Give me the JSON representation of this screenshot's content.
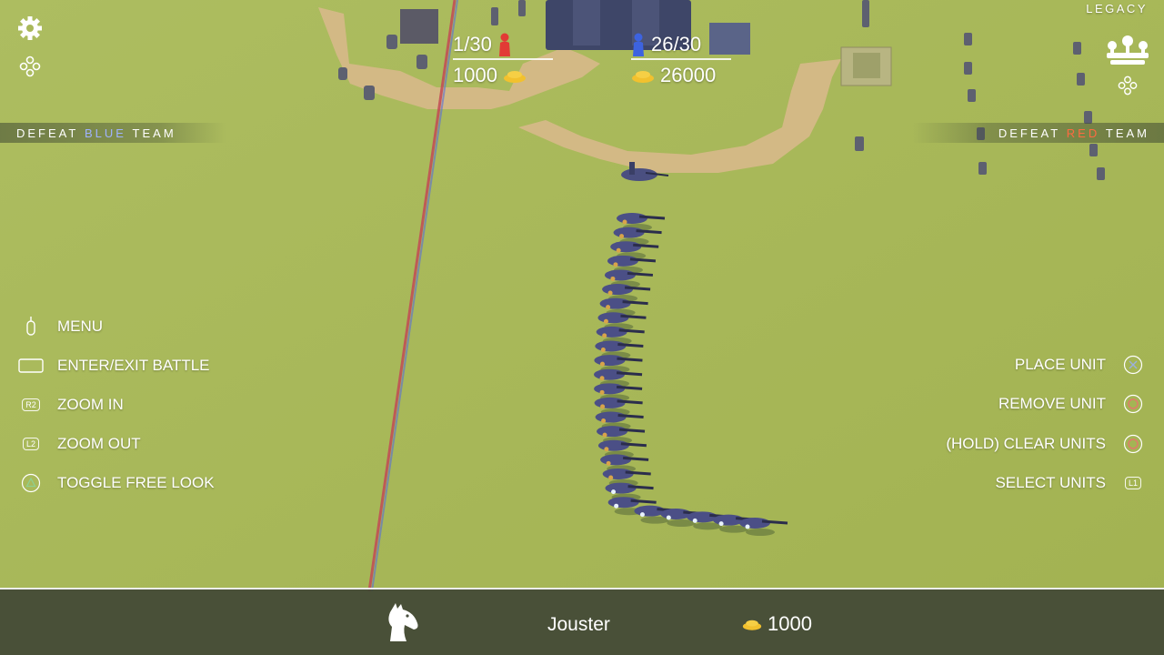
{
  "window": {
    "legacy_label": "LEGACY"
  },
  "teams": {
    "red": {
      "units": "1/30",
      "gold": "1000",
      "color": "#e23b35"
    },
    "blue": {
      "units": "26/30",
      "gold": "26000",
      "color": "#3d63e0"
    }
  },
  "objectives": {
    "left": {
      "prefix": "DEFEAT",
      "team": "BLUE",
      "suffix": "TEAM",
      "team_color": "#9fb3ff"
    },
    "right": {
      "prefix": "DEFEAT",
      "team": "RED",
      "suffix": "TEAM",
      "team_color": "#ff6a40"
    }
  },
  "controls_left": [
    {
      "label": "MENU",
      "icon": "menu-key-icon"
    },
    {
      "label": "ENTER/EXIT BATTLE",
      "icon": "touchpad-key-icon"
    },
    {
      "label": "ZOOM IN",
      "icon": "r2-key-icon",
      "key": "R2"
    },
    {
      "label": "ZOOM OUT",
      "icon": "l2-key-icon",
      "key": "L2"
    },
    {
      "label": "TOGGLE FREE LOOK",
      "icon": "triangle-key-icon"
    }
  ],
  "controls_right": [
    {
      "label": "PLACE UNIT",
      "icon": "cross-key-icon"
    },
    {
      "label": "REMOVE UNIT",
      "icon": "circle-key-icon"
    },
    {
      "label": "(HOLD) CLEAR UNITS",
      "icon": "circle-key-icon"
    },
    {
      "label": "SELECT UNITS",
      "icon": "l1-key-icon",
      "key": "L1"
    }
  ],
  "selected_unit": {
    "name": "Jouster",
    "cost": "1000",
    "icon": "horse-head-icon"
  },
  "icons": {
    "settings": "gear-icon",
    "gamepad": "dpad-icon",
    "faction": "legacy-faction-icon",
    "gold": "gold-pile-icon"
  },
  "colors": {
    "gold": "#f2c12e",
    "grass": "#a9b85a"
  }
}
